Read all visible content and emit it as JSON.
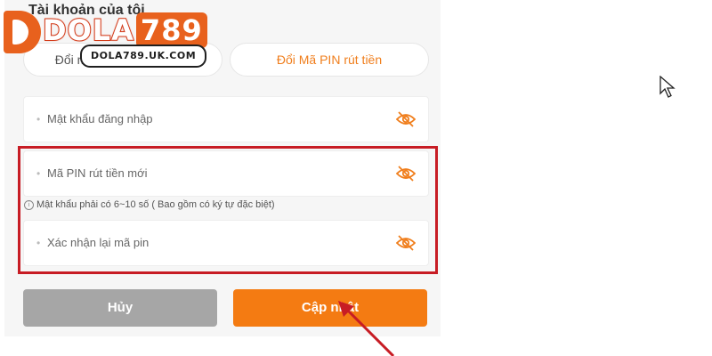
{
  "header": {
    "title": "Tài khoản của tôi"
  },
  "logo": {
    "brand": "DOLA",
    "number": "789",
    "url": "DOLA789.UK.COM"
  },
  "tabs": [
    {
      "label": "Đổi mật khẩu đăng nhập",
      "active": false
    },
    {
      "label": "Đổi Mã PIN rút tiền",
      "active": true
    }
  ],
  "fields": {
    "login_password": {
      "label": "Mật khẩu đăng nhập",
      "required_mark": "•",
      "icon": "eye-slash-icon"
    },
    "new_pin": {
      "label": "Mã PIN rút tiền mới",
      "required_mark": "•",
      "icon": "eye-slash-icon"
    },
    "confirm_pin": {
      "label": "Xác nhận lại mã pin",
      "required_mark": "•",
      "icon": "eye-slash-icon"
    }
  },
  "hint": {
    "icon": "info-icon",
    "icon_glyph": "i",
    "text": "Mật khẩu phải có 6~10 số ( Bao gồm có ký tự đặc biệt)"
  },
  "buttons": {
    "cancel": "Hủy",
    "update": "Cập nhật"
  },
  "colors": {
    "accent": "#f47b12",
    "cancel": "#a6a6a6",
    "highlight": "#c71c24",
    "annotation_arrow": "#c71c24"
  }
}
